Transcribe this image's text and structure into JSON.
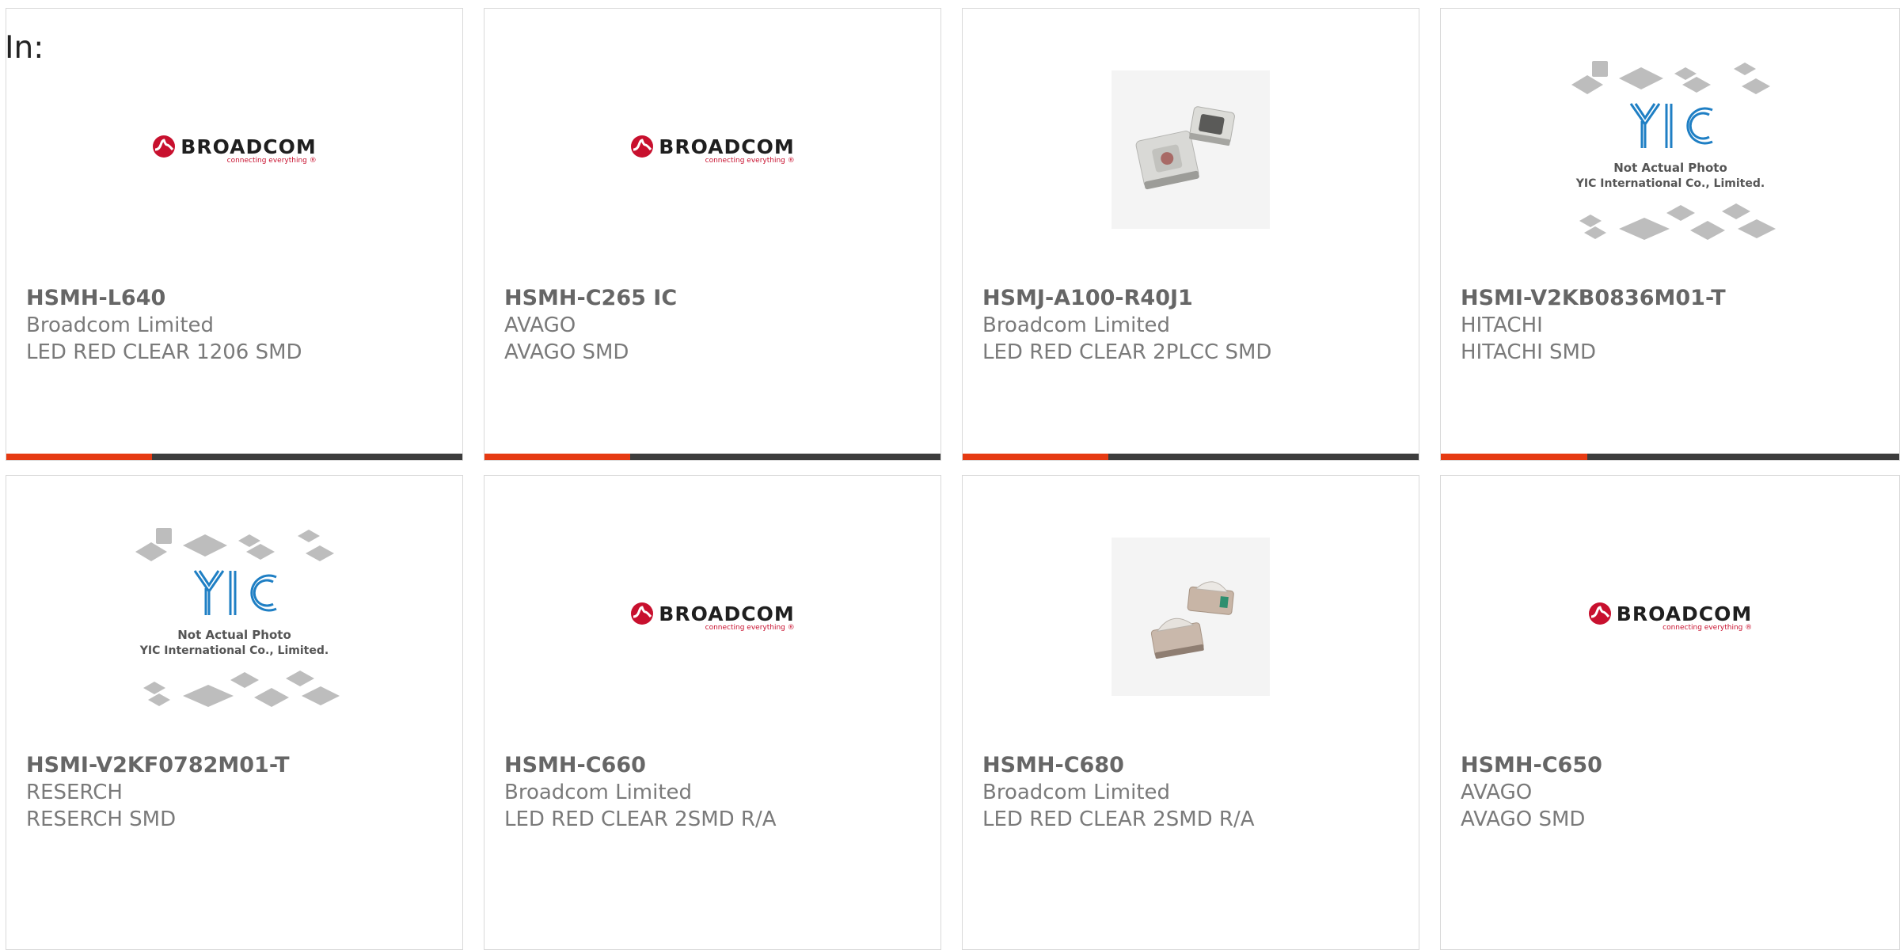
{
  "page": {
    "label": "In:"
  },
  "brand_colors": {
    "accent": "#e63a12",
    "bar_track": "#3d3d3d",
    "broadcom_red": "#c8102e",
    "yic_blue": "#1f7fc4"
  },
  "logos": {
    "broadcom": {
      "word": "BROADCOM",
      "mark": "®",
      "tagline": "connecting everything ®"
    },
    "yic": {
      "mark": "YIC",
      "line1": "Not Actual Photo",
      "line2": "YIC International Co., Limited."
    }
  },
  "products": [
    {
      "part": "HSMH-L640",
      "manufacturer": "Broadcom Limited",
      "description": "LED RED CLEAR 1206 SMD",
      "image": "broadcom-logo",
      "progress": 0.32
    },
    {
      "part": "HSMH-C265 IC",
      "manufacturer": "AVAGO",
      "description": "AVAGO SMD",
      "image": "broadcom-logo",
      "progress": 0.32
    },
    {
      "part": "HSMJ-A100-R40J1",
      "manufacturer": "Broadcom Limited",
      "description": "LED RED CLEAR 2PLCC SMD",
      "image": "led-photo-plcc",
      "progress": 0.32
    },
    {
      "part": "HSMI-V2KB0836M01-T",
      "manufacturer": "HITACHI",
      "description": "HITACHI SMD",
      "image": "yic-placeholder",
      "progress": 0.32
    },
    {
      "part": "HSMI-V2KF0782M01-T",
      "manufacturer": "RESERCH",
      "description": "RESERCH SMD",
      "image": "yic-placeholder",
      "progress": 0
    },
    {
      "part": "HSMH-C660",
      "manufacturer": "Broadcom Limited",
      "description": "LED RED CLEAR 2SMD R/A",
      "image": "broadcom-logo",
      "progress": 0
    },
    {
      "part": "HSMH-C680",
      "manufacturer": "Broadcom Limited",
      "description": "LED RED CLEAR 2SMD R/A",
      "image": "led-photo-ra",
      "progress": 0
    },
    {
      "part": "HSMH-C650",
      "manufacturer": "AVAGO",
      "description": "AVAGO SMD",
      "image": "broadcom-logo",
      "progress": 0
    }
  ]
}
